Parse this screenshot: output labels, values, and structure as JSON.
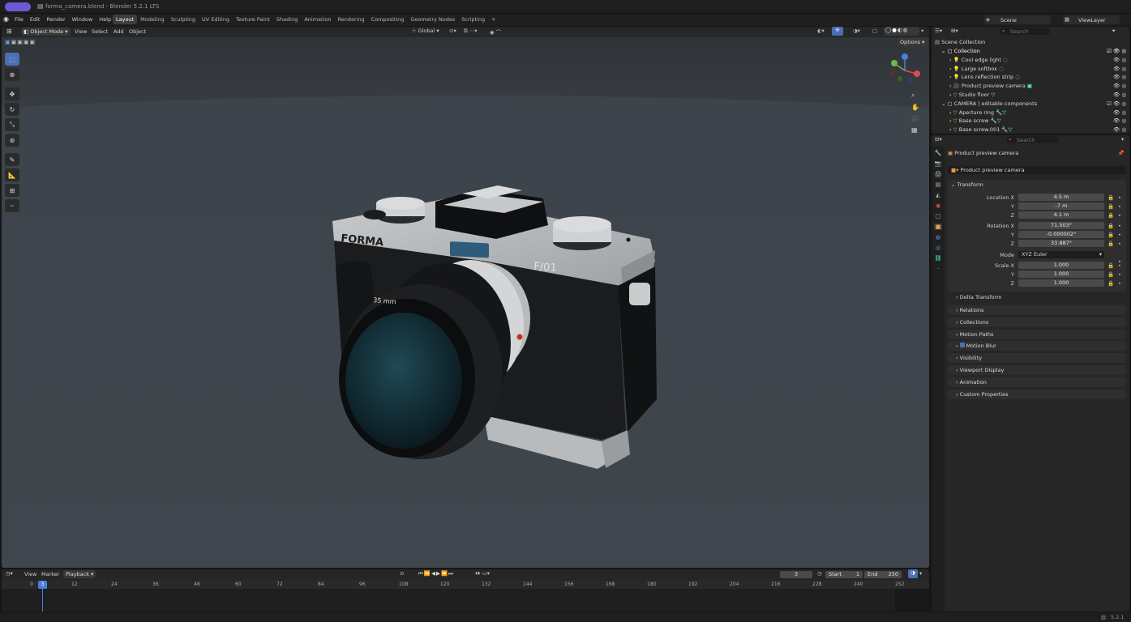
{
  "window": {
    "title": "forma_camera.blend - Blender 5.2.1 LTS",
    "version": "5.2.1"
  },
  "menu": [
    "File",
    "Edit",
    "Render",
    "Window",
    "Help"
  ],
  "workspaces": [
    "Layout",
    "Modeling",
    "Sculpting",
    "UV Editing",
    "Texture Paint",
    "Shading",
    "Animation",
    "Rendering",
    "Compositing",
    "Geometry Nodes",
    "Scripting"
  ],
  "active_workspace": "Layout",
  "scene": {
    "scene_name": "Scene",
    "view_layer": "ViewLayer"
  },
  "viewport": {
    "mode": "Object Mode",
    "menus": [
      "View",
      "Select",
      "Add",
      "Object"
    ],
    "orientation": "Global",
    "options": "Options",
    "camera_labels": {
      "brand": "FORMA",
      "model": "F/01",
      "lens": "35 mm"
    }
  },
  "outliner": {
    "search_placeholder": "Search",
    "root": "Scene Collection",
    "rows": [
      {
        "name": "Collection",
        "level": 0
      },
      {
        "name": "Cool edge light",
        "level": 1
      },
      {
        "name": "Large softbox",
        "level": 1
      },
      {
        "name": "Lens reflection strip",
        "level": 1
      },
      {
        "name": "Product preview camera",
        "level": 1
      },
      {
        "name": "Studio floor",
        "level": 1
      },
      {
        "name": "CAMERA | editable components",
        "level": 0
      },
      {
        "name": "Aperture ring",
        "level": 1
      },
      {
        "name": "Base screw",
        "level": 1
      },
      {
        "name": "Base screw.001",
        "level": 1
      }
    ]
  },
  "properties": {
    "search_placeholder": "Search",
    "object_name": "Product preview camera",
    "data_name": "Product preview camera",
    "transform": {
      "header": "Transform",
      "location": {
        "label": "Location X",
        "x": "4.5 m",
        "y": "-7 m",
        "z": "4.1 m"
      },
      "rotation": {
        "label": "Rotation X",
        "x": "71.503°",
        "y": "-0.000002°",
        "z": "33.887°"
      },
      "mode_label": "Mode",
      "mode": "XYZ Euler",
      "scale": {
        "label": "Scale X",
        "x": "1.000",
        "y": "1.000",
        "z": "1.000"
      },
      "y_label": "Y",
      "z_label": "Z",
      "delta": "Delta Transform"
    },
    "panels": [
      "Relations",
      "Collections",
      "Motion Paths",
      "Motion Blur",
      "Visibility",
      "Viewport Display",
      "Animation",
      "Custom Properties"
    ]
  },
  "timeline": {
    "menus": [
      "View",
      "Marker",
      "Playback"
    ],
    "current_frame": "3",
    "start_label": "Start",
    "start": "1",
    "end_label": "End",
    "end": "250",
    "ticks": [
      "0",
      "12",
      "24",
      "36",
      "48",
      "60",
      "72",
      "84",
      "96",
      "108",
      "120",
      "132",
      "144",
      "156",
      "168",
      "180",
      "192",
      "204",
      "216",
      "228",
      "240",
      "252"
    ],
    "frame_marker": "3"
  },
  "status": {
    "version": "5.2.1"
  }
}
